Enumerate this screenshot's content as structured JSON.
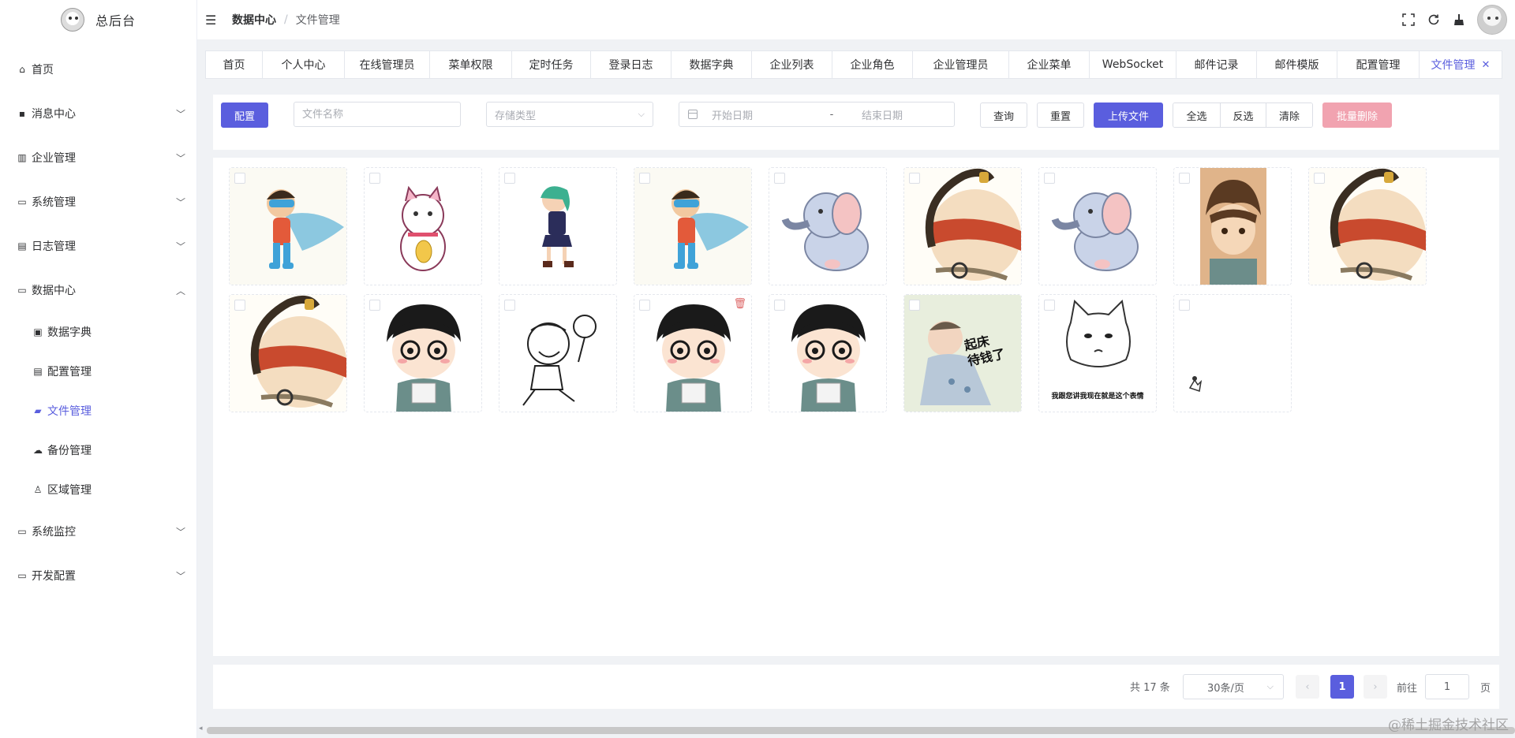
{
  "brand": {
    "title": "总后台"
  },
  "sidebar": {
    "menu_top": [
      {
        "label": "首页",
        "icon": "home-icon"
      },
      {
        "label": "消息中心",
        "icon": "message-icon",
        "expandable": true
      },
      {
        "label": "企业管理",
        "icon": "chart-icon",
        "expandable": true
      },
      {
        "label": "系统管理",
        "icon": "monitor-icon",
        "expandable": true
      },
      {
        "label": "日志管理",
        "icon": "log-icon",
        "expandable": true
      },
      {
        "label": "数据中心",
        "icon": "monitor-icon",
        "expandable": true,
        "expanded": true
      }
    ],
    "submenu": [
      {
        "label": "数据字典",
        "icon": "book-icon"
      },
      {
        "label": "配置管理",
        "icon": "document-icon"
      },
      {
        "label": "文件管理",
        "icon": "folder-icon",
        "active": true
      },
      {
        "label": "备份管理",
        "icon": "cloud-icon"
      },
      {
        "label": "区域管理",
        "icon": "user-icon"
      }
    ],
    "menu_bottom": [
      {
        "label": "系统监控",
        "icon": "monitor-icon",
        "expandable": true
      },
      {
        "label": "开发配置",
        "icon": "monitor-icon",
        "expandable": true
      }
    ]
  },
  "header": {
    "breadcrumb": [
      "数据中心",
      "文件管理"
    ],
    "icons": [
      "fullscreen-icon",
      "refresh-icon",
      "clean-icon"
    ]
  },
  "tags": [
    {
      "label": "首页"
    },
    {
      "label": "个人中心"
    },
    {
      "label": "在线管理员"
    },
    {
      "label": "菜单权限"
    },
    {
      "label": "定时任务"
    },
    {
      "label": "登录日志"
    },
    {
      "label": "数据字典"
    },
    {
      "label": "企业列表"
    },
    {
      "label": "企业角色"
    },
    {
      "label": "企业管理员"
    },
    {
      "label": "企业菜单"
    },
    {
      "label": "WebSocket"
    },
    {
      "label": "邮件记录"
    },
    {
      "label": "邮件模版"
    },
    {
      "label": "配置管理"
    },
    {
      "label": "文件管理",
      "active": true,
      "closable": true
    }
  ],
  "toolbar": {
    "config_button": "配置",
    "filename_placeholder": "文件名称",
    "storage_placeholder": "存储类型",
    "start_date_placeholder": "开始日期",
    "date_separator": "-",
    "end_date_placeholder": "结束日期",
    "query_button": "查询",
    "reset_button": "重置",
    "upload_button": "上传文件",
    "select_all": "全选",
    "invert_select": "反选",
    "clear": "清除",
    "batch_delete": "批量删除"
  },
  "files": [
    {
      "kind": "superhero"
    },
    {
      "kind": "lucky-cat"
    },
    {
      "kind": "walking-girl"
    },
    {
      "kind": "superhero"
    },
    {
      "kind": "elephant"
    },
    {
      "kind": "blindfold-monk"
    },
    {
      "kind": "elephant"
    },
    {
      "kind": "anime-boy"
    },
    {
      "kind": "blindfold-monk"
    },
    {
      "kind": "blindfold-monk"
    },
    {
      "kind": "glasses-boy"
    },
    {
      "kind": "lollipop-sketch"
    },
    {
      "kind": "glasses-boy",
      "hover_delete": true
    },
    {
      "kind": "glasses-boy"
    },
    {
      "kind": "baby-meme",
      "caption": "起床\n待钱了"
    },
    {
      "kind": "cat-meme",
      "caption": "我跟您讲我现在就是这个表情"
    },
    {
      "kind": "tiny-sketch"
    }
  ],
  "pagination": {
    "total_text": "共 17 条",
    "page_size": "30条/页",
    "current_page": "1",
    "goto_label": "前往",
    "goto_value": "1",
    "page_suffix": "页"
  },
  "watermark": "@稀土掘金技术社区"
}
